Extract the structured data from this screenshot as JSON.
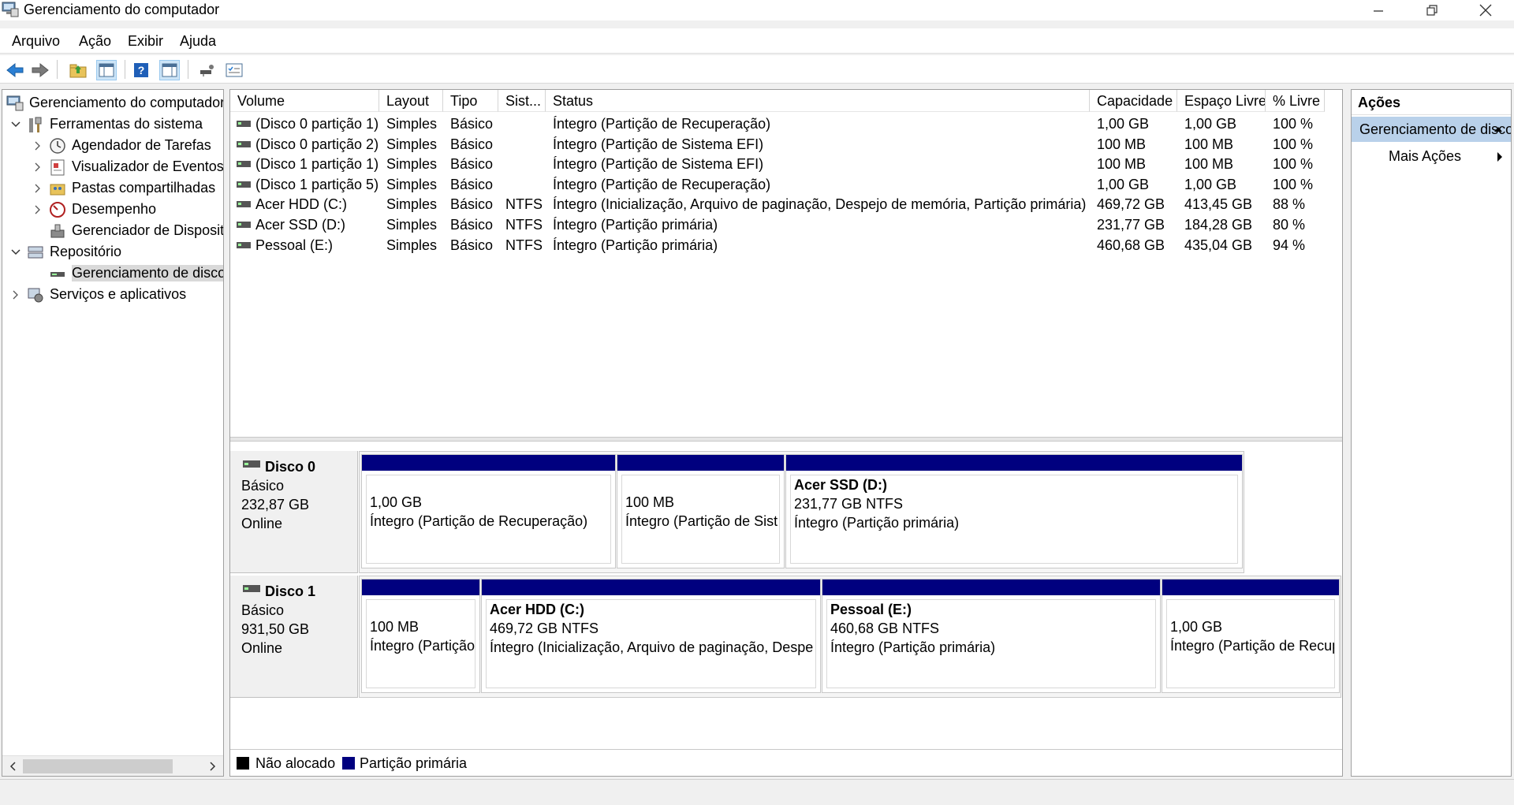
{
  "window": {
    "title": "Gerenciamento do computador",
    "controls": [
      "minimize",
      "restore",
      "close"
    ]
  },
  "menu": [
    "Arquivo",
    "Ação",
    "Exibir",
    "Ajuda"
  ],
  "toolbar": {
    "icons": [
      "back-arrow-icon",
      "forward-arrow-icon",
      "up-folder-icon",
      "show-hide-tree-icon",
      "help-icon",
      "show-hide-action-pane-icon",
      "connect-disk-icon",
      "properties-checklist-icon"
    ]
  },
  "tree": {
    "root": "Gerenciamento do computador",
    "items": [
      {
        "label": "Ferramentas do sistema",
        "level": 1,
        "expanded": true
      },
      {
        "label": "Agendador de Tarefas",
        "level": 2
      },
      {
        "label": "Visualizador de Eventos",
        "level": 2
      },
      {
        "label": "Pastas compartilhadas",
        "level": 2
      },
      {
        "label": "Desempenho",
        "level": 2
      },
      {
        "label": "Gerenciador de Dispositivos",
        "level": 2
      },
      {
        "label": "Repositório",
        "level": 1,
        "expanded": true
      },
      {
        "label": "Gerenciamento de disco",
        "level": 2,
        "selected": true
      },
      {
        "label": "Serviços e aplicativos",
        "level": 1
      }
    ]
  },
  "volumes": {
    "columns": [
      "Volume",
      "Layout",
      "Tipo",
      "Sist...",
      "Status",
      "Capacidade",
      "Espaço Livre",
      "% Livre"
    ],
    "rows": [
      [
        "(Disco 0 partição 1)",
        "Simples",
        "Básico",
        "",
        "Íntegro (Partição de Recuperação)",
        "1,00 GB",
        "1,00 GB",
        "100 %"
      ],
      [
        "(Disco 0 partição 2)",
        "Simples",
        "Básico",
        "",
        "Íntegro (Partição de Sistema EFI)",
        "100 MB",
        "100 MB",
        "100 %"
      ],
      [
        "(Disco 1 partição 1)",
        "Simples",
        "Básico",
        "",
        "Íntegro (Partição de Sistema EFI)",
        "100 MB",
        "100 MB",
        "100 %"
      ],
      [
        "(Disco 1 partição 5)",
        "Simples",
        "Básico",
        "",
        "Íntegro (Partição de Recuperação)",
        "1,00 GB",
        "1,00 GB",
        "100 %"
      ],
      [
        "Acer HDD (C:)",
        "Simples",
        "Básico",
        "NTFS",
        "Íntegro (Inicialização, Arquivo de paginação, Despejo de memória, Partição primária)",
        "469,72 GB",
        "413,45 GB",
        "88 %"
      ],
      [
        "Acer SSD (D:)",
        "Simples",
        "Básico",
        "NTFS",
        "Íntegro (Partição primária)",
        "231,77 GB",
        "184,28 GB",
        "80 %"
      ],
      [
        "Pessoal (E:)",
        "Simples",
        "Básico",
        "NTFS",
        "Íntegro (Partição primária)",
        "460,68 GB",
        "435,04 GB",
        "94 %"
      ]
    ]
  },
  "disks": [
    {
      "name": "Disco 0",
      "type": "Básico",
      "size": "232,87 GB",
      "state": "Online",
      "partitions": [
        {
          "name": "",
          "size": "1,00 GB",
          "status": "Íntegro (Partição de Recuperação)"
        },
        {
          "name": "",
          "size": "100 MB",
          "status": "Íntegro (Partição de Sist"
        },
        {
          "name": "Acer SSD  (D:)",
          "size": "231,77 GB NTFS",
          "status": "Íntegro (Partição primária)"
        }
      ]
    },
    {
      "name": "Disco 1",
      "type": "Básico",
      "size": "931,50 GB",
      "state": "Online",
      "partitions": [
        {
          "name": "",
          "size": "100 MB",
          "status": "Íntegro (Partição"
        },
        {
          "name": "Acer HDD  (C:)",
          "size": "469,72 GB NTFS",
          "status": "Íntegro (Inicialização, Arquivo de paginação, Despe"
        },
        {
          "name": "Pessoal  (E:)",
          "size": "460,68 GB NTFS",
          "status": "Íntegro (Partição primária)"
        },
        {
          "name": "",
          "size": "1,00 GB",
          "status": "Íntegro (Partição de Recup"
        }
      ]
    }
  ],
  "legend": {
    "items": [
      {
        "label": "Não alocado",
        "color": "#000000"
      },
      {
        "label": "Partição primária",
        "color": "#00007f"
      }
    ]
  },
  "actions": {
    "header": "Ações",
    "selected": "Gerenciamento de disco",
    "more": "Mais Ações"
  },
  "colors": {
    "partition_bar": "#00007f",
    "selection": "#b9d1ea"
  }
}
